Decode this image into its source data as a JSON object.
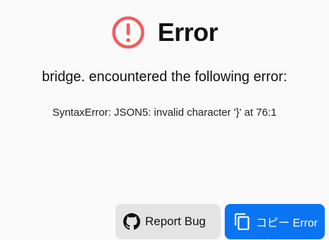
{
  "header": {
    "icon": "error-circle-icon",
    "icon_color": "#f25c5c",
    "title": "Error"
  },
  "message": "bridge. encountered the following error:",
  "detail": "SyntaxError: JSON5: invalid character '}' at 76:1",
  "actions": {
    "report": {
      "icon": "github-icon",
      "label": "Report Bug",
      "background": "#e4e4e4"
    },
    "copy": {
      "icon": "copy-icon",
      "label": "コピー Error",
      "background": "#0a74f2"
    }
  }
}
